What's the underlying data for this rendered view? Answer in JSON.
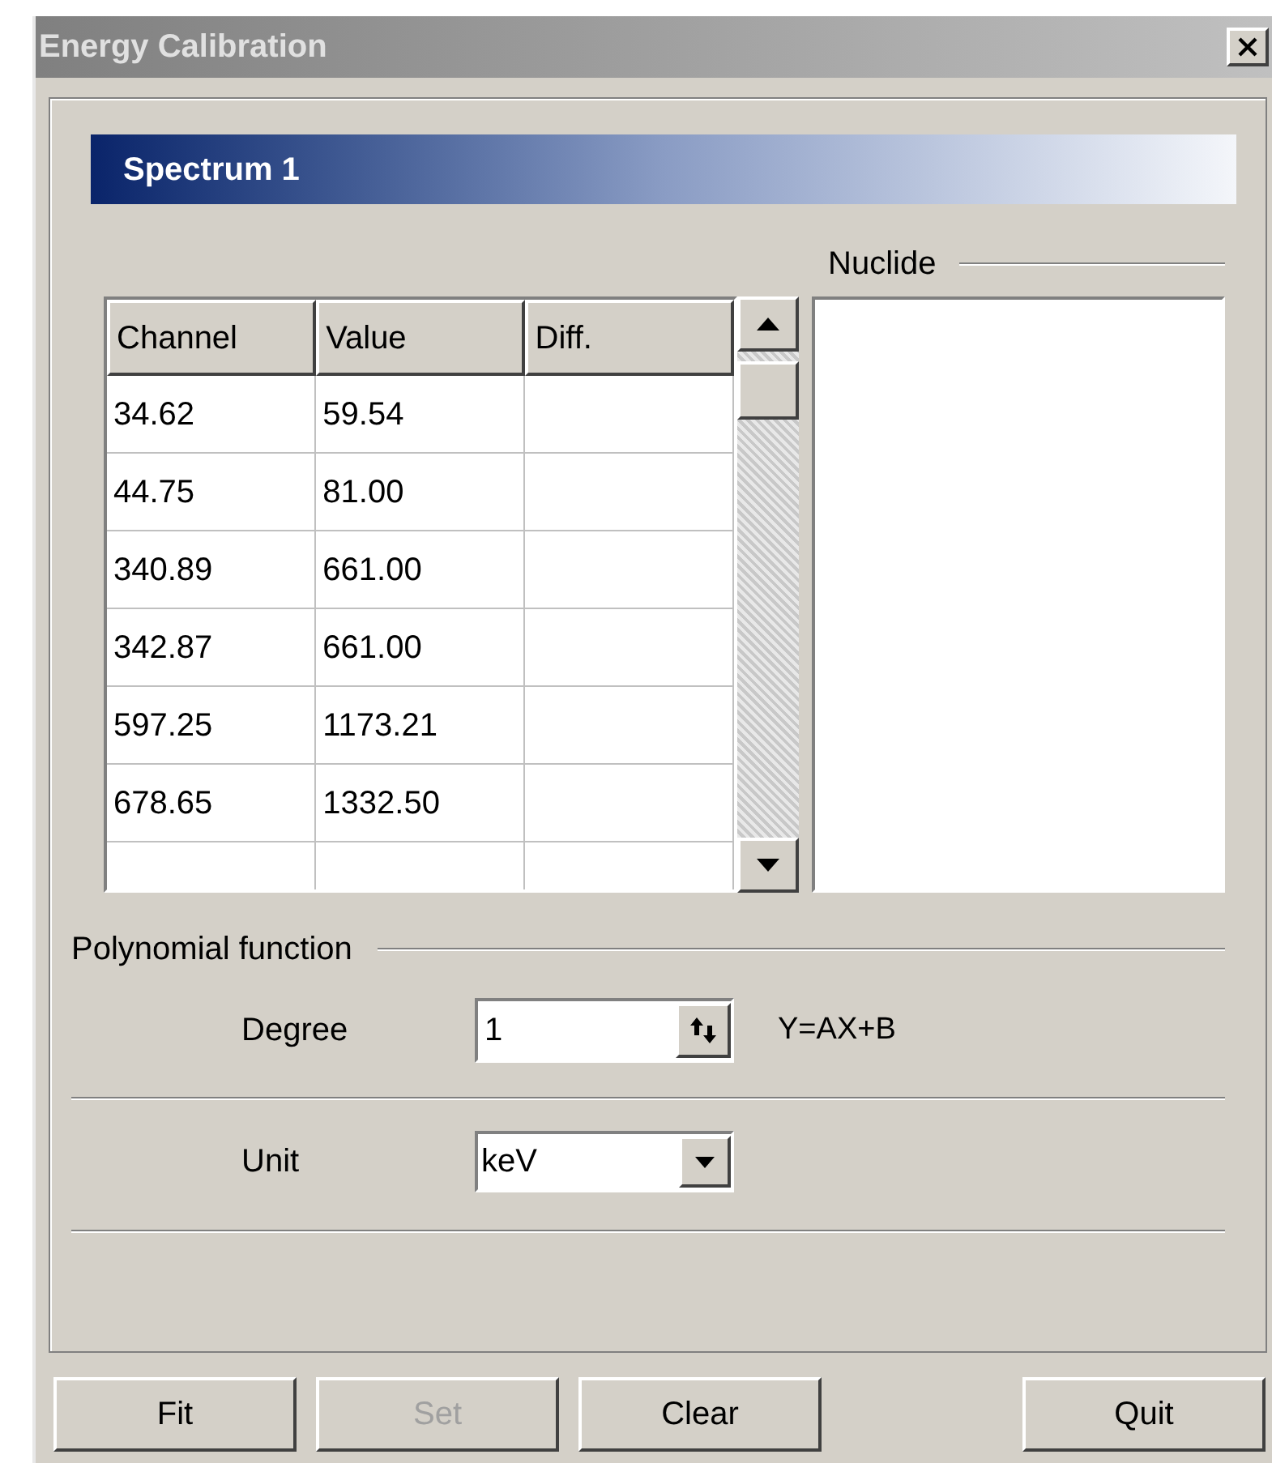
{
  "window": {
    "title": "Energy Calibration"
  },
  "header": "Spectrum 1",
  "nuclide": {
    "label": "Nuclide"
  },
  "table": {
    "columns": [
      "Channel",
      "Value",
      "Diff."
    ],
    "rows": [
      [
        "34.62",
        "59.54"
      ],
      [
        "44.75",
        "81.00"
      ],
      [
        "340.89",
        "661.00"
      ],
      [
        "342.87",
        "661.00"
      ],
      [
        "597.25",
        "1173.21"
      ],
      [
        "678.65",
        "1332.50"
      ]
    ]
  },
  "polynomial": {
    "label": "Polynomial function",
    "degree_label": "Degree",
    "degree_value": "1",
    "formula": "Y=AX+B"
  },
  "unit": {
    "label": "Unit",
    "value": "keV"
  },
  "buttons": [
    {
      "label": "Fit",
      "disabled": false
    },
    {
      "label": "Set",
      "disabled": true
    },
    {
      "label": "Clear",
      "disabled": false
    },
    {
      "label": "Quit",
      "disabled": false
    }
  ]
}
